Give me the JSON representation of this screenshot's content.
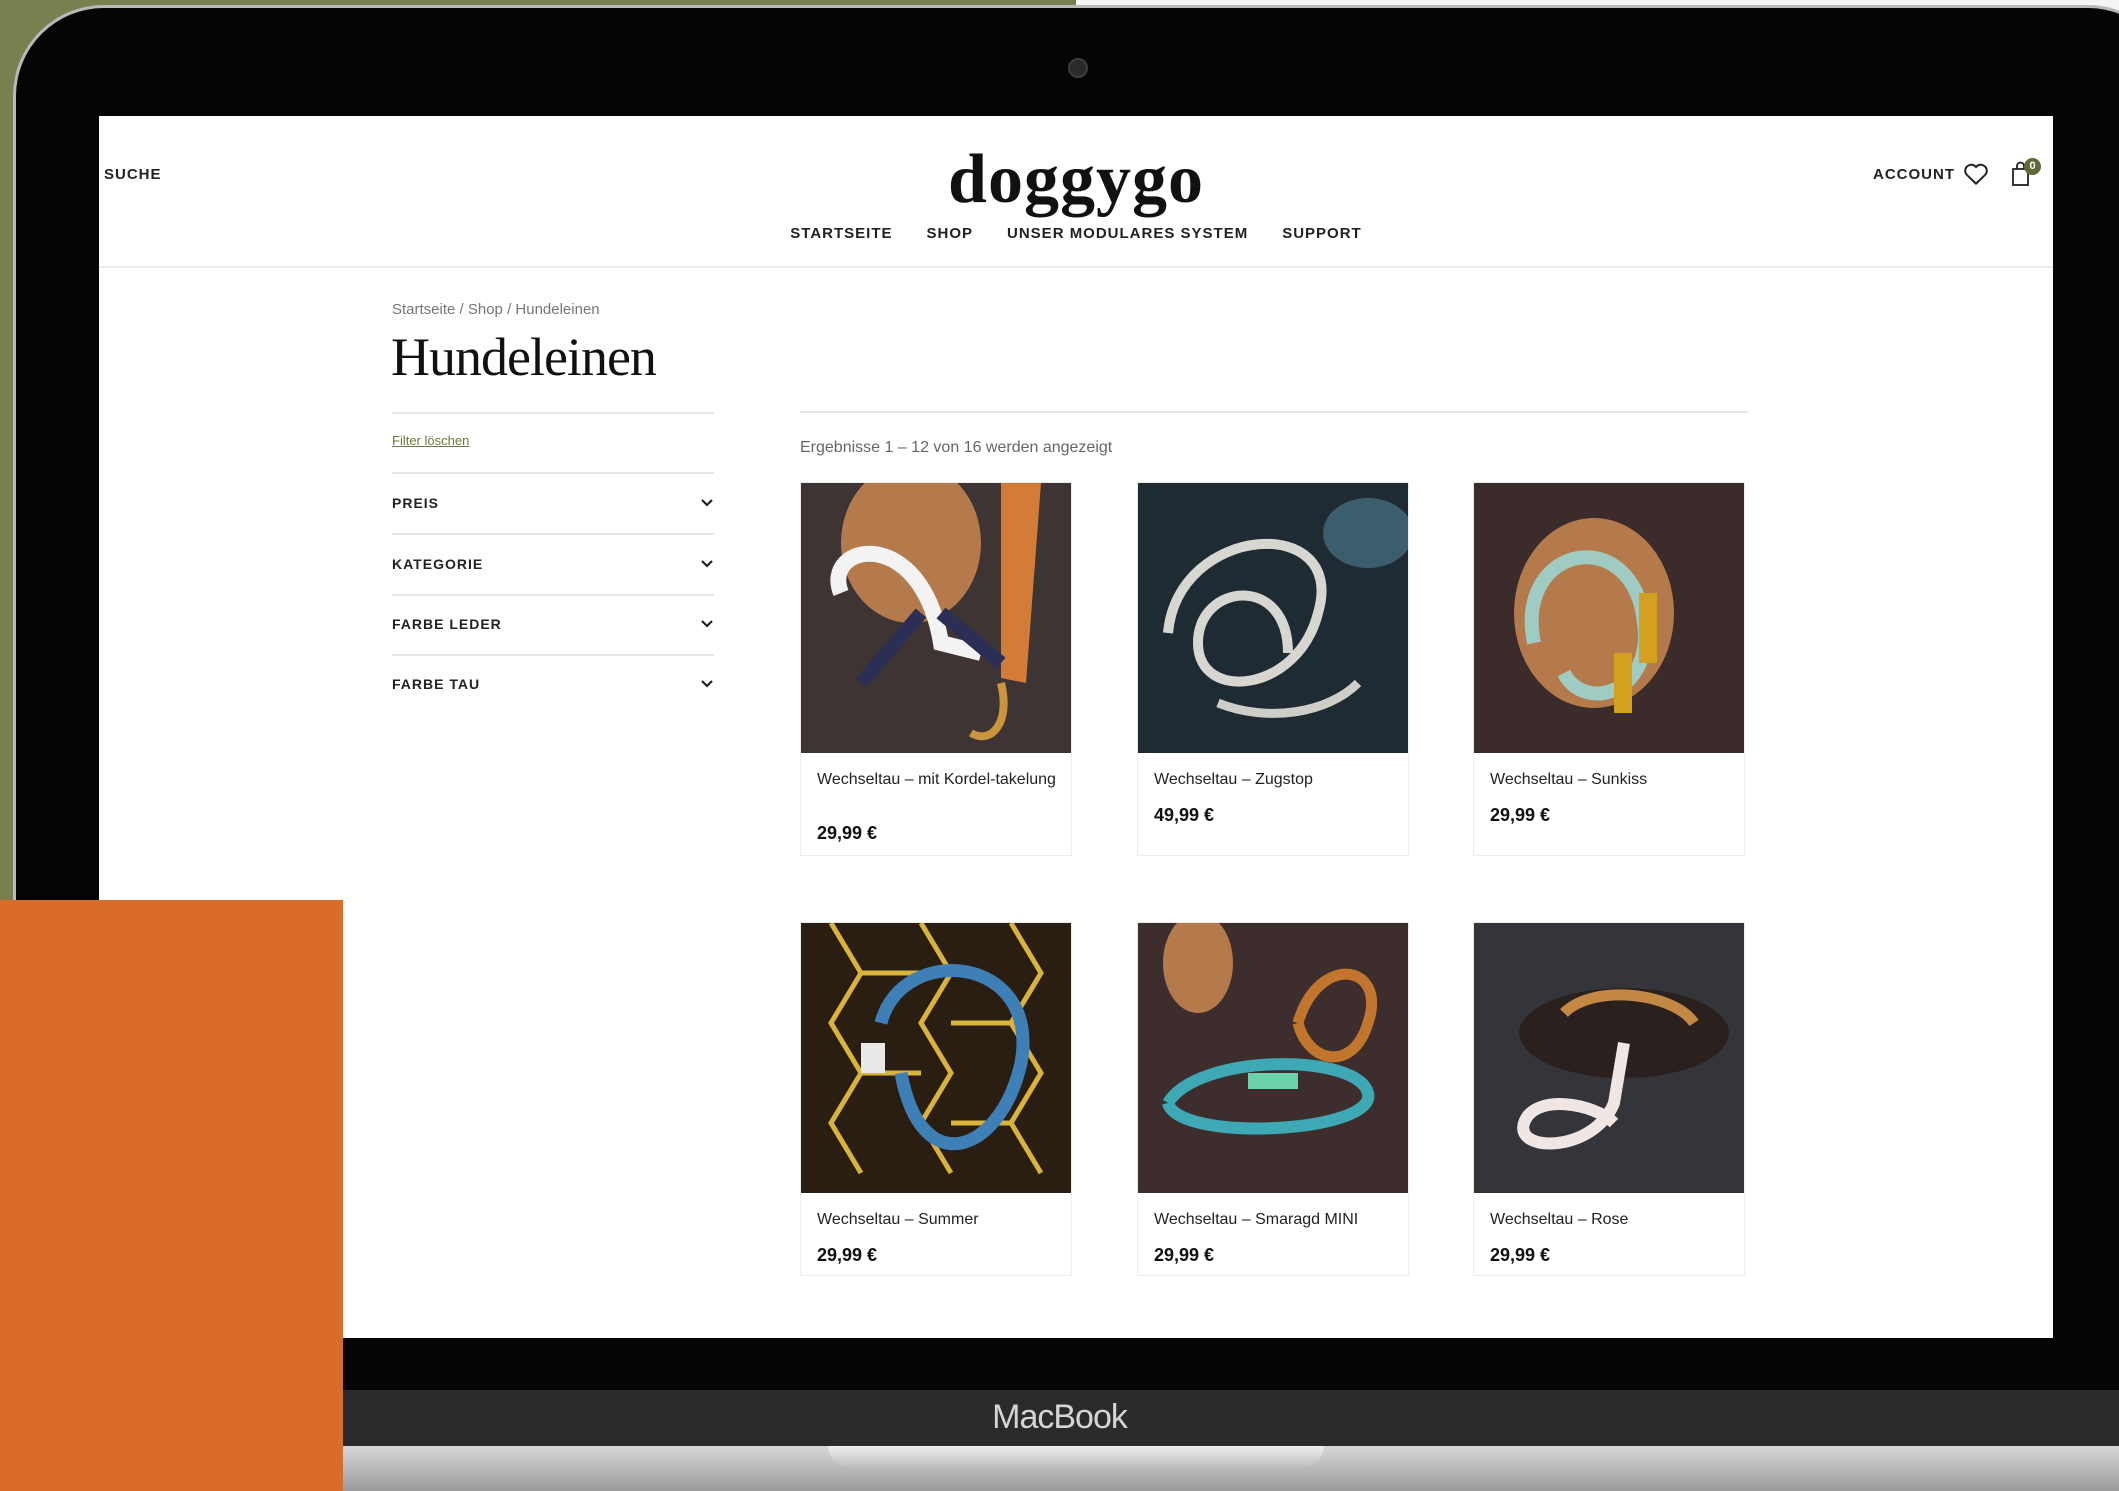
{
  "device": {
    "label": "MacBook"
  },
  "header": {
    "search_label": "SUCHE",
    "logo": "doggygo",
    "account_label": "ACCOUNT",
    "cart_count": "0",
    "nav": [
      {
        "label": "STARTSEITE"
      },
      {
        "label": "SHOP"
      },
      {
        "label": "UNSER MODULARES SYSTEM"
      },
      {
        "label": "SUPPORT"
      }
    ]
  },
  "page": {
    "breadcrumb": "Startseite / Shop / Hundeleinen",
    "title": "Hundeleinen",
    "results_text": "Ergebnisse 1 – 12 von 16 werden angezeigt"
  },
  "sidebar": {
    "clear_filters": "Filter löschen",
    "facets": [
      {
        "label": "PREIS"
      },
      {
        "label": "KATEGORIE"
      },
      {
        "label": "FARBE LEDER"
      },
      {
        "label": "FARBE TAU"
      }
    ]
  },
  "products": [
    {
      "name": "Wechseltau – mit Kordel-takelung",
      "price": "29,99 €"
    },
    {
      "name": "Wechseltau – Zugstop",
      "price": "49,99 €"
    },
    {
      "name": "Wechseltau – Sunkiss",
      "price": "29,99 €"
    },
    {
      "name": "Wechseltau – Summer",
      "price": "29,99 €"
    },
    {
      "name": "Wechseltau – Smaragd MINI",
      "price": "29,99 €"
    },
    {
      "name": "Wechseltau – Rose",
      "price": "29,99 €"
    }
  ],
  "colors": {
    "olive_backdrop": "#7a7f4f",
    "orange_block": "#d96b2b",
    "accent_green": "#6a7a3c"
  }
}
